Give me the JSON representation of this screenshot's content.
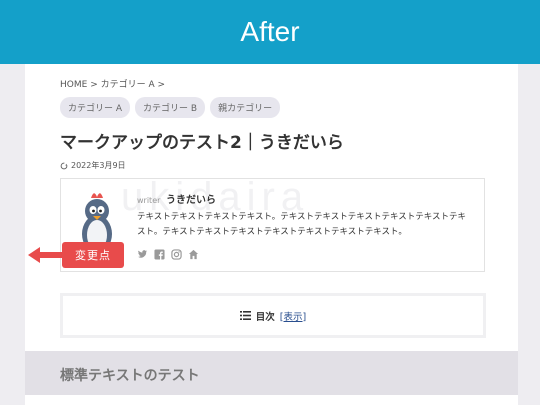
{
  "banner": {
    "label": "After"
  },
  "breadcrumb": {
    "home": "HOME",
    "separator": ">",
    "category": "カテゴリー A"
  },
  "tags": [
    "カテゴリー A",
    "カテゴリー B",
    "親カテゴリー"
  ],
  "post": {
    "title": "マークアップのテスト2｜うきだいら",
    "date": "2022年3月9日"
  },
  "author": {
    "watermark": "ukidaira",
    "writer_label": "writer",
    "name": "うきだいら",
    "bio": "テキストテキストテキストテキスト。テキストテキストテキストテキストテキストテキスト。テキストテキストテキストテキストテキストテキストテキスト。"
  },
  "socials": [
    "twitter-icon",
    "facebook-icon",
    "instagram-icon",
    "home-icon"
  ],
  "toc": {
    "label": "目次",
    "toggle": "[表示]"
  },
  "section": {
    "title": "標準テキストのテスト"
  },
  "annotation": {
    "label": "変更点"
  },
  "colors": {
    "banner": "#14a0c9",
    "badge": "#e84b4b",
    "page_bg": "#eeedf1"
  }
}
